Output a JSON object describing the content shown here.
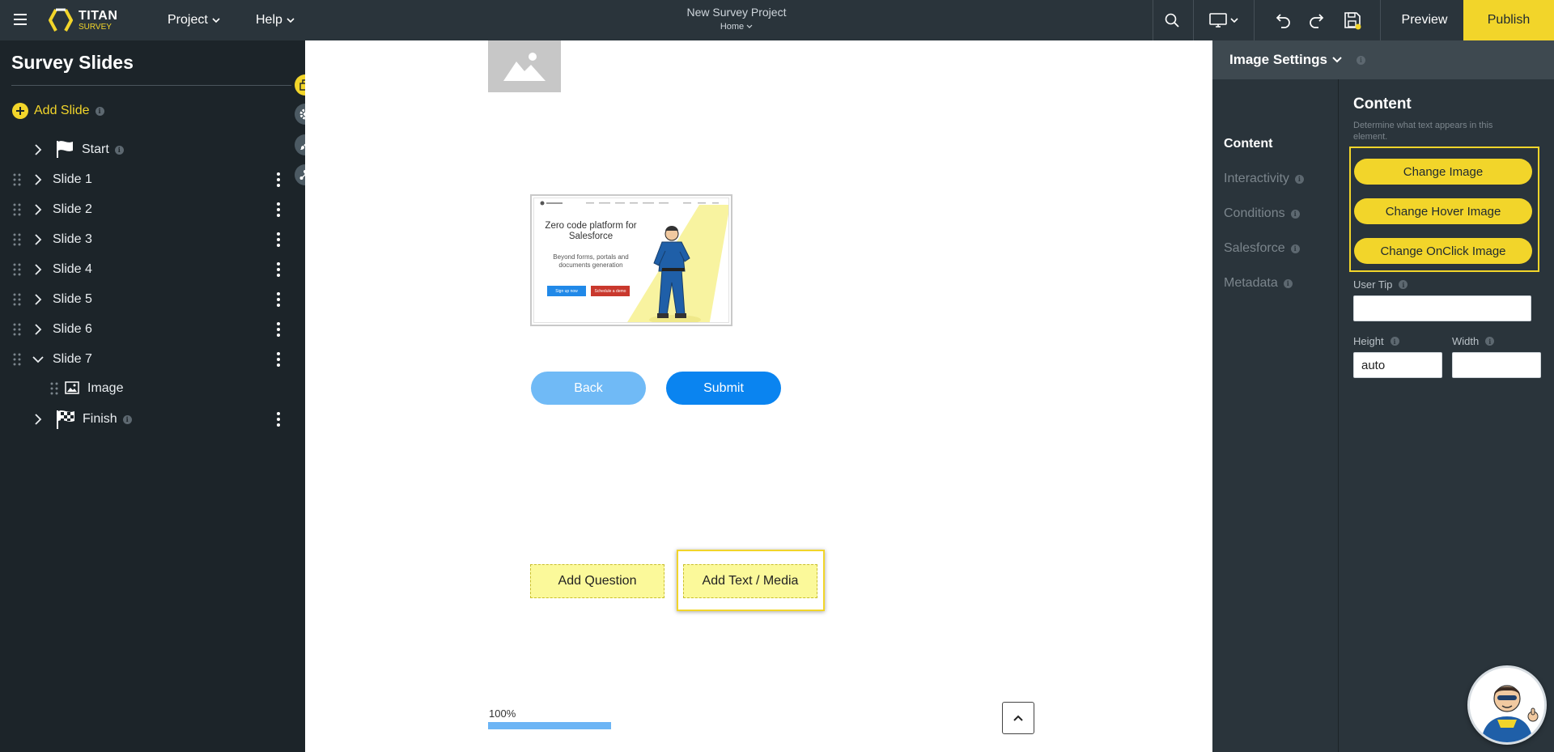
{
  "app": {
    "logo_titan": "TITAN",
    "logo_survey": "SURVEY",
    "menu_project": "Project",
    "menu_help": "Help",
    "project_title": "New Survey Project",
    "project_page": "Home",
    "preview": "Preview",
    "publish": "Publish"
  },
  "sidebar": {
    "title": "Survey Slides",
    "add_slide": "Add Slide",
    "info": "i",
    "start": "Start",
    "slides": [
      "Slide 1",
      "Slide 2",
      "Slide 3",
      "Slide 4",
      "Slide 5",
      "Slide 6",
      "Slide 7"
    ],
    "child_image": "Image",
    "finish": "Finish"
  },
  "canvas": {
    "preview": {
      "headline": "Zero code platform for Salesforce",
      "subline": "Beyond forms, portals and documents generation",
      "btn1": "Sign up now",
      "btn2": "Schedule a demo"
    },
    "back": "Back",
    "submit": "Submit",
    "add_question": "Add Question",
    "add_text_media": "Add Text / Media",
    "progress_label": "100%",
    "progress_value": 1.0
  },
  "panel": {
    "header": "Image Settings",
    "nav": [
      "Content",
      "Interactivity",
      "Conditions",
      "Salesforce",
      "Metadata"
    ],
    "content_title": "Content",
    "content_desc": "Determine what text appears in this element.",
    "change_image": "Change Image",
    "change_hover_image": "Change Hover Image",
    "change_onclick_image": "Change OnClick Image",
    "user_tip_label": "User Tip",
    "user_tip_value": "",
    "height_label": "Height",
    "height_value": "auto",
    "width_label": "Width",
    "width_value": ""
  },
  "colors": {
    "accent": "#f2d52a",
    "topbar": "#2a343b",
    "sidebar": "#1c2429",
    "primary_blue": "#0a84f0"
  }
}
